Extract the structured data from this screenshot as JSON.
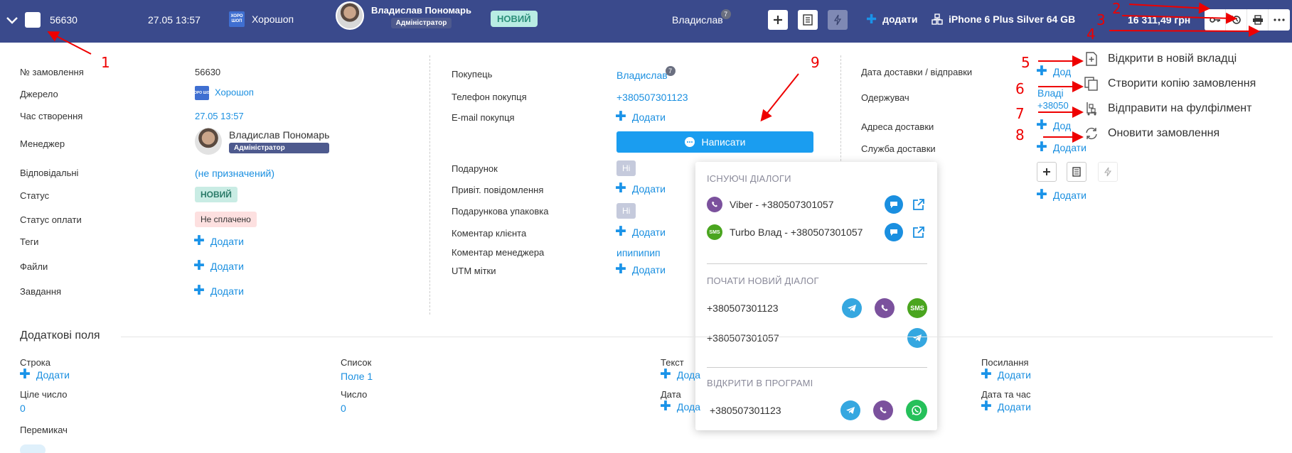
{
  "header": {
    "order_number": "56630",
    "created": "27.05 13:57",
    "source_name": "Хорошоп",
    "source_logo_text": "ХОРО ШОП",
    "manager_name": "Владислав Пономарь",
    "manager_role": "Адміністратор",
    "status": "НОВИЙ",
    "buyer_name": "Владислав",
    "buyer_badge_count": "7",
    "add_label": "додати",
    "product_name": "iPhone 6 Plus Silver 64 GB",
    "total_price": "16 311,49 грн"
  },
  "order": {
    "labels": {
      "number": "№ замовлення",
      "source": "Джерело",
      "created": "Час створення",
      "manager": "Менеджер",
      "responsible": "Відповідальні",
      "status": "Статус",
      "payment_status": "Статус оплати",
      "tags": "Теги",
      "files": "Файли",
      "tasks": "Завдання"
    },
    "values": {
      "number": "56630",
      "source": "Хорошоп",
      "created": "27.05 13:57",
      "manager_name": "Владислав Пономарь",
      "manager_role": "Адміністратор",
      "responsible": "(не призначений)",
      "status": "НОВИЙ",
      "payment_status": "Не сплачено",
      "add": "Додати"
    }
  },
  "buyer": {
    "labels": {
      "buyer": "Покупець",
      "phone": "Телефон покупця",
      "email": "E-mail покупця",
      "gift": "Подарунок",
      "greeting": "Привіт. повідомлення",
      "gift_wrap": "Подарункова упаковка",
      "client_comment": "Коментар клієнта",
      "manager_comment": "Коментар менеджера",
      "utm": "UTM мітки"
    },
    "values": {
      "buyer": "Владислав",
      "buyer_badge": "7",
      "phone": "+380507301123",
      "add": "Додати",
      "gift": "Ні",
      "gift_wrap": "Ні",
      "manager_comment": "ипипипип",
      "write_button": "Написати"
    }
  },
  "delivery": {
    "labels": {
      "date": "Дата доставки / відправки",
      "recipient": "Одержувач",
      "address": "Адреса доставки",
      "service": "Служба доставки"
    },
    "values": {
      "date_add": "Дод",
      "recipient_name": "Владі",
      "recipient_phone": "+38050",
      "address_add": "Дод",
      "service_add": "Додати",
      "add": "Додати"
    }
  },
  "dialog_popup": {
    "existing_title": "ІСНУЮЧІ ДІАЛОГИ",
    "existing": [
      {
        "label": "Viber - +380507301057",
        "icon": "viber-icon"
      },
      {
        "label": "Turbo Влад - +380507301057",
        "icon": "sms-icon"
      }
    ],
    "new_title": "ПОЧАТИ НОВИЙ ДІАЛОГ",
    "new_phones": [
      "+380507301123",
      "+380507301057"
    ],
    "sms_text": "SMS",
    "open_title": "ВІДКРИТИ В ПРОГРАМІ",
    "open_phone": "+380507301123"
  },
  "actions_menu": {
    "items": [
      {
        "label": "Відкрити в новій вкладці",
        "icon": "open-tab-icon"
      },
      {
        "label": "Створити копію замовлення",
        "icon": "copy-icon"
      },
      {
        "label": "Відправити на фулфілмент",
        "icon": "fulfillment-icon"
      },
      {
        "label": "Оновити замовлення",
        "icon": "refresh-icon"
      }
    ]
  },
  "extra_fields": {
    "title": "Додаткові поля",
    "fields": [
      {
        "label": "Строка",
        "value": "Додати",
        "kind": "add"
      },
      {
        "label": "Список",
        "value": "Поле 1",
        "kind": "link"
      },
      {
        "label": "Текст",
        "value": "Дода",
        "kind": "add"
      },
      {
        "label": "Посилання",
        "value": "Додати",
        "kind": "add"
      },
      {
        "label": "Ціле число",
        "value": "0",
        "kind": "link"
      },
      {
        "label": "Число",
        "value": "0",
        "kind": "link"
      },
      {
        "label": "Дата",
        "value": "Дода",
        "kind": "add"
      },
      {
        "label": "Дата та час",
        "value": "Додати",
        "kind": "add"
      },
      {
        "label": "Перемикач",
        "value": "",
        "kind": "toggle"
      }
    ]
  },
  "annotations": [
    "1",
    "2",
    "3",
    "4",
    "5",
    "6",
    "7",
    "8",
    "9"
  ],
  "colors": {
    "header_bg": "#3a4a8c",
    "link": "#1a8fe0",
    "annotation": "#e00000",
    "status_bg": "#b9ece3"
  }
}
